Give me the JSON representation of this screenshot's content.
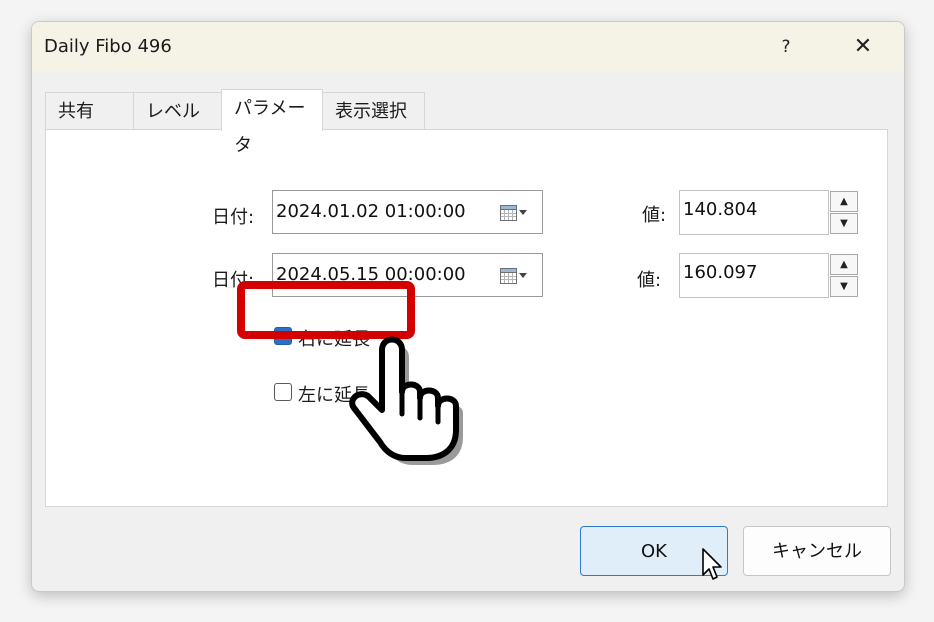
{
  "window": {
    "title": "Daily Fibo 496",
    "help_label": "?",
    "close_label": "✕"
  },
  "tabs": [
    {
      "label": "共有",
      "active": false
    },
    {
      "label": "レベル",
      "active": false
    },
    {
      "label": "パラメータ",
      "active": true
    },
    {
      "label": "表示選択",
      "active": false
    }
  ],
  "params": {
    "row1": {
      "date_label": "日付:",
      "date_value": "2024.01.02 01:00:00",
      "value_label": "値:",
      "value": "140.804"
    },
    "row2": {
      "date_label": "日付:",
      "date_value": "2024.05.15 00:00:00",
      "value_label": "値:",
      "value": "160.097"
    },
    "extend_right": {
      "label": "右に延長",
      "checked": true
    },
    "extend_left": {
      "label": "左に延長",
      "checked": false
    }
  },
  "buttons": {
    "ok": "OK",
    "cancel": "キャンセル"
  },
  "spinner": {
    "up": "▲",
    "down": "▼"
  },
  "colors": {
    "accent": "#2a6fc4",
    "highlight": "#d40000",
    "titlebar": "#f5f2e6"
  }
}
